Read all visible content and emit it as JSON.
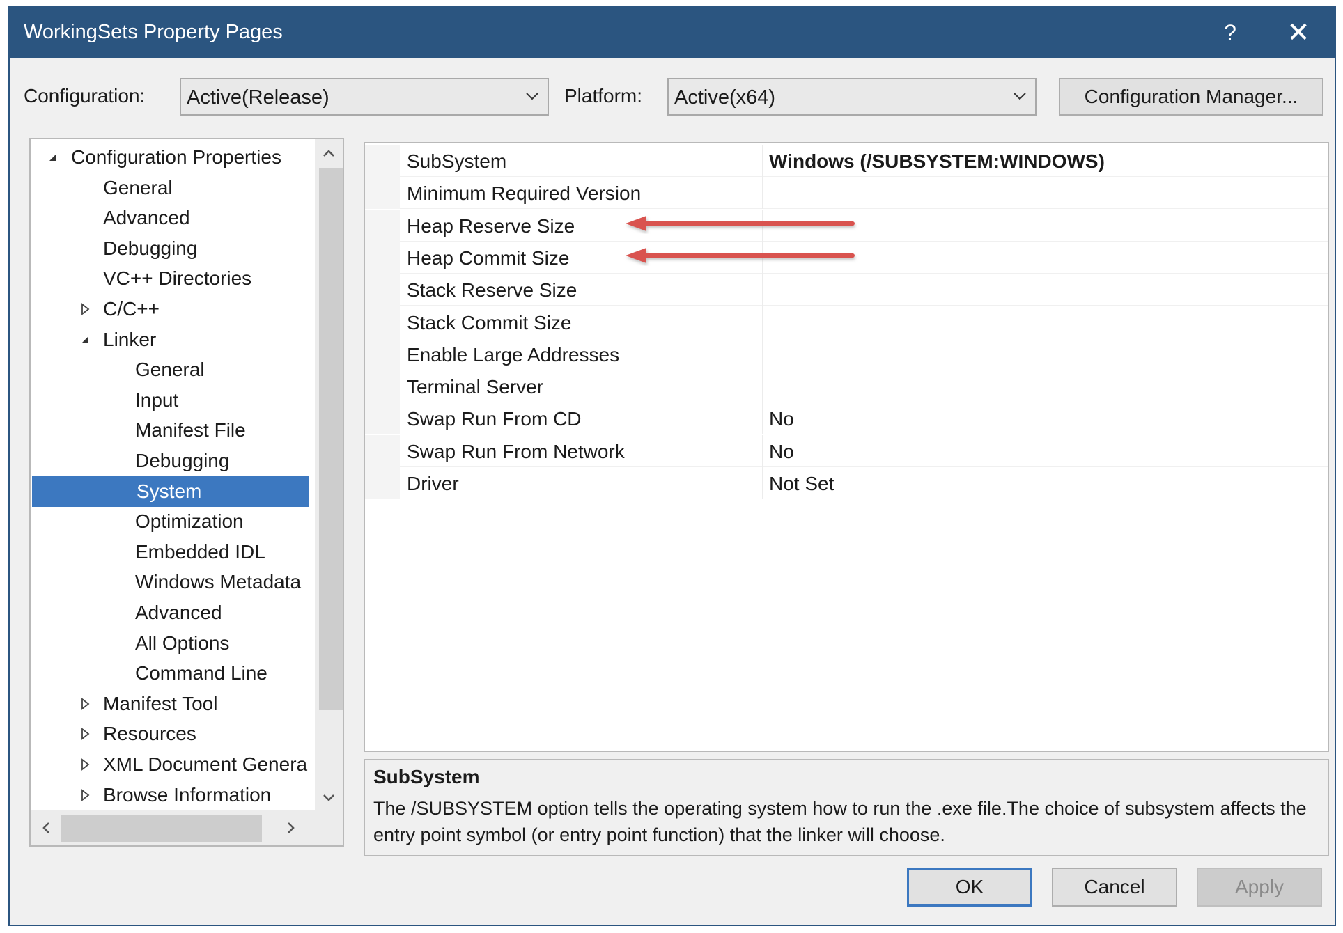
{
  "window": {
    "title": "WorkingSets Property Pages",
    "help_glyph": "?",
    "close_glyph": "✕"
  },
  "config": {
    "configuration_label": "Configuration:",
    "configuration_value": "Active(Release)",
    "platform_label": "Platform:",
    "platform_value": "Active(x64)",
    "manager_button": "Configuration Manager..."
  },
  "tree": {
    "items": [
      {
        "label": "Configuration Properties",
        "expander": "expanded"
      },
      {
        "label": "General",
        "expander": "none"
      },
      {
        "label": "Advanced",
        "expander": "none"
      },
      {
        "label": "Debugging",
        "expander": "none"
      },
      {
        "label": "VC++ Directories",
        "expander": "none"
      },
      {
        "label": "C/C++",
        "expander": "collapsed"
      },
      {
        "label": "Linker",
        "expander": "expanded"
      },
      {
        "label": "General",
        "expander": "none"
      },
      {
        "label": "Input",
        "expander": "none"
      },
      {
        "label": "Manifest File",
        "expander": "none"
      },
      {
        "label": "Debugging",
        "expander": "none"
      },
      {
        "label": "System",
        "expander": "none",
        "selected": true
      },
      {
        "label": "Optimization",
        "expander": "none"
      },
      {
        "label": "Embedded IDL",
        "expander": "none"
      },
      {
        "label": "Windows Metadata",
        "expander": "none"
      },
      {
        "label": "Advanced",
        "expander": "none"
      },
      {
        "label": "All Options",
        "expander": "none"
      },
      {
        "label": "Command Line",
        "expander": "none"
      },
      {
        "label": "Manifest Tool",
        "expander": "collapsed"
      },
      {
        "label": "Resources",
        "expander": "collapsed"
      },
      {
        "label": "XML Document Genera",
        "expander": "collapsed"
      },
      {
        "label": "Browse Information",
        "expander": "collapsed"
      }
    ]
  },
  "properties": [
    {
      "name": "SubSystem",
      "value": "Windows (/SUBSYSTEM:WINDOWS)",
      "bold": true
    },
    {
      "name": "Minimum Required Version",
      "value": ""
    },
    {
      "name": "Heap Reserve Size",
      "value": ""
    },
    {
      "name": "Heap Commit Size",
      "value": ""
    },
    {
      "name": "Stack Reserve Size",
      "value": ""
    },
    {
      "name": "Stack Commit Size",
      "value": ""
    },
    {
      "name": "Enable Large Addresses",
      "value": ""
    },
    {
      "name": "Terminal Server",
      "value": ""
    },
    {
      "name": "Swap Run From CD",
      "value": "No"
    },
    {
      "name": "Swap Run From Network",
      "value": "No"
    },
    {
      "name": "Driver",
      "value": "Not Set"
    }
  ],
  "description": {
    "title": "SubSystem",
    "text": "The /SUBSYSTEM option tells the operating system how to run the .exe file.The choice of subsystem affects the entry point symbol (or entry point function) that the linker will choose."
  },
  "buttons": {
    "ok": "OK",
    "cancel": "Cancel",
    "apply": "Apply"
  },
  "colors": {
    "titlebar": "#2b5580",
    "selection": "#3c78c0",
    "annotation_arrow": "#d9534f"
  }
}
